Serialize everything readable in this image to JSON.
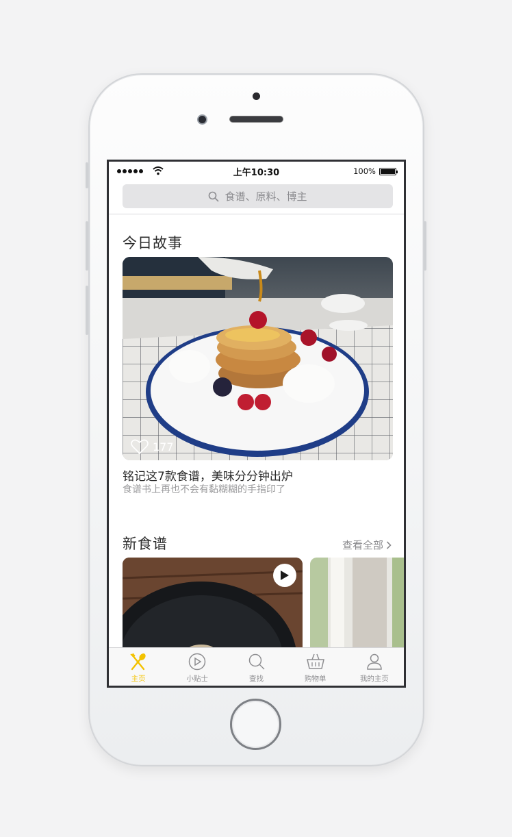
{
  "status_bar": {
    "time": "上午10:30",
    "battery": "100%"
  },
  "search": {
    "placeholder": "食谱、原料、博主"
  },
  "today_story": {
    "section_title": "今日故事",
    "likes": "177",
    "headline": "铭记这7款食谱，美味分分钟出炉",
    "subtitle": "食谱书上再也不会有黏糊糊的手指印了"
  },
  "new_recipes": {
    "section_title": "新食谱",
    "view_all": "查看全部"
  },
  "tabs": [
    {
      "label": "主页",
      "icon": "fork-spoon-icon",
      "active": true
    },
    {
      "label": "小贴士",
      "icon": "play-circle-icon",
      "active": false
    },
    {
      "label": "查找",
      "icon": "search-icon",
      "active": false
    },
    {
      "label": "购物单",
      "icon": "basket-icon",
      "active": false
    },
    {
      "label": "我的主页",
      "icon": "user-icon",
      "active": false
    }
  ],
  "colors": {
    "accent": "#f3c200",
    "text_primary": "#2c2c2c",
    "text_secondary": "#9a9a9c"
  }
}
